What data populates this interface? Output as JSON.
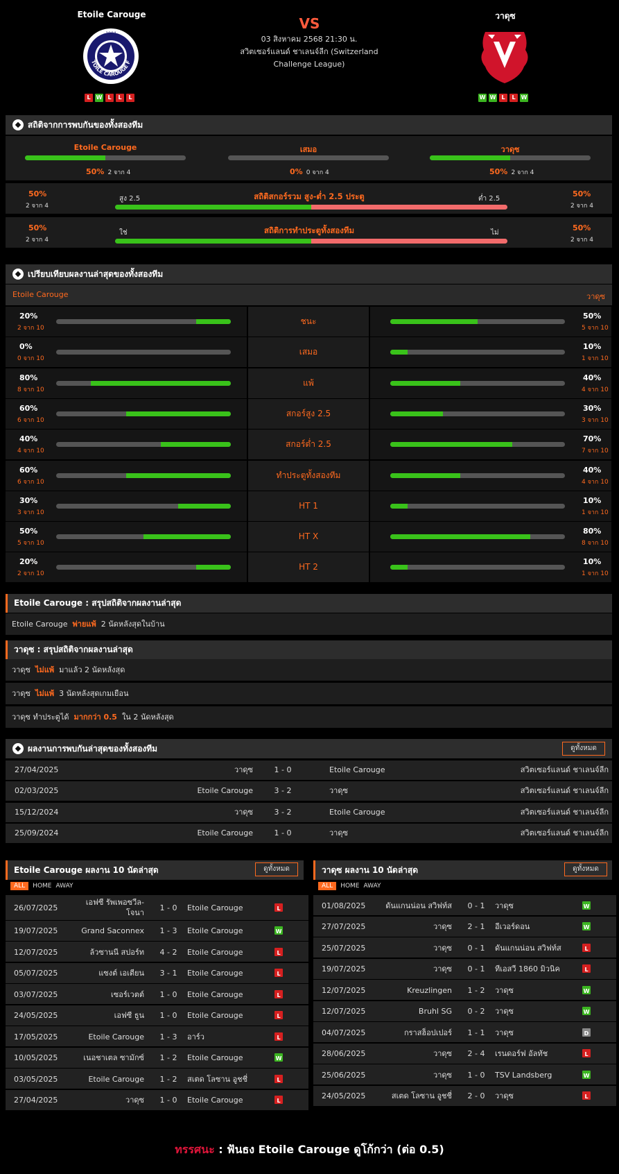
{
  "match": {
    "home": "Etoile Carouge",
    "away": "วาดุซ",
    "vs": "VS",
    "date": "03 สิงหาคม 2568 21:30 น.",
    "league1": "สวิตเซอร์แลนด์ ชาเลนจ์ลีก (Switzerland",
    "league2": "Challenge League)",
    "home_form": [
      "L",
      "W",
      "L",
      "L",
      "L"
    ],
    "away_form": [
      "W",
      "W",
      "L",
      "L",
      "W"
    ],
    "home_logo_text": "ETOILE CAROUGE FC",
    "home_logo_year": "1904"
  },
  "h2h_stats": {
    "title": "สถิติจากการพบกันของทั้งสองทีม",
    "cols": [
      {
        "label": "Etoile Carouge",
        "pct": "50%",
        "of": "2 จาก 4",
        "fill": 0.5
      },
      {
        "label": "เสมอ",
        "pct": "0%",
        "of": "0 จาก 4",
        "fill": 0
      },
      {
        "label": "วาดุซ",
        "pct": "50%",
        "of": "2 จาก 4",
        "fill": 0.5
      }
    ],
    "ou": {
      "title": "สถิติสกอร์รวม สูง-ต่ำ 2.5 ประตู",
      "left_label": "สูง 2.5",
      "right_label": "ต่ำ 2.5",
      "lpct": "50%",
      "lof": "2 จาก 4",
      "rpct": "50%",
      "rof": "2 จาก 4",
      "fill": 0.5
    },
    "btts": {
      "title": "สถิติการทำประตูทั้งสองทีม",
      "left_label": "ใช่",
      "right_label": "ไม่",
      "lpct": "50%",
      "lof": "2 จาก 4",
      "rpct": "50%",
      "rof": "2 จาก 4",
      "fill": 0.5
    }
  },
  "compare": {
    "title": "เปรียบเทียบผลงานล่าสุดของทั้งสองทีม",
    "home": "Etoile Carouge",
    "away": "วาดุซ",
    "rows": [
      {
        "label": "ชนะ",
        "lp": "20%",
        "lo": "2 จาก 10",
        "lf": 0.2,
        "rp": "50%",
        "ro": "5 จาก 10",
        "rf": 0.5
      },
      {
        "label": "เสมอ",
        "lp": "0%",
        "lo": "0 จาก 10",
        "lf": 0,
        "rp": "10%",
        "ro": "1 จาก 10",
        "rf": 0.1
      },
      {
        "label": "แพ้",
        "lp": "80%",
        "lo": "8 จาก 10",
        "lf": 0.8,
        "rp": "40%",
        "ro": "4 จาก 10",
        "rf": 0.4
      },
      {
        "label": "สกอร์สูง 2.5",
        "lp": "60%",
        "lo": "6 จาก 10",
        "lf": 0.6,
        "rp": "30%",
        "ro": "3 จาก 10",
        "rf": 0.3
      },
      {
        "label": "สกอร์ต่ำ 2.5",
        "lp": "40%",
        "lo": "4 จาก 10",
        "lf": 0.4,
        "rp": "70%",
        "ro": "7 จาก 10",
        "rf": 0.7
      },
      {
        "label": "ทำประตูทั้งสองทีม",
        "lp": "60%",
        "lo": "6 จาก 10",
        "lf": 0.6,
        "rp": "40%",
        "ro": "4 จาก 10",
        "rf": 0.4
      },
      {
        "label": "HT 1",
        "lp": "30%",
        "lo": "3 จาก 10",
        "lf": 0.3,
        "rp": "10%",
        "ro": "1 จาก 10",
        "rf": 0.1
      },
      {
        "label": "HT X",
        "lp": "50%",
        "lo": "5 จาก 10",
        "lf": 0.5,
        "rp": "80%",
        "ro": "8 จาก 10",
        "rf": 0.8
      },
      {
        "label": "HT 2",
        "lp": "20%",
        "lo": "2 จาก 10",
        "lf": 0.2,
        "rp": "10%",
        "ro": "1 จาก 10",
        "rf": 0.1
      }
    ]
  },
  "summary_home": {
    "title": "Etoile Carouge : สรุปสถิติจากผลงานล่าสุด",
    "rows": [
      {
        "a": "Etoile Carouge",
        "b": "พ่ายแพ้",
        "c": "2 นัดหลังสุดในบ้าน"
      }
    ]
  },
  "summary_away": {
    "title": "วาดุซ : สรุปสถิติจากผลงานล่าสุด",
    "rows": [
      {
        "a": "วาดุซ",
        "b": "ไม่แพ้",
        "c": "มาแล้ว 2 นัดหลังสุด"
      },
      {
        "a": "วาดุซ",
        "b": "ไม่แพ้",
        "c": "3 นัดหลังสุดเกมเยือน"
      }
    ],
    "row3": {
      "a": "วาดุซ ทำประตูได้",
      "b": "มากกว่า 0.5",
      "c": "ใน 2 นัดหลังสุด"
    }
  },
  "h2h_results": {
    "title": "ผลงานการพบกันล่าสุดของทั้งสองทีม",
    "button": "ดูทั้งหมด",
    "rows": [
      {
        "date": "27/04/2025",
        "home": "วาดุซ",
        "score": "1 - 0",
        "away": "Etoile Carouge",
        "league": "สวิตเซอร์แลนด์ ชาเลนจ์ลีก"
      },
      {
        "date": "02/03/2025",
        "home": "Etoile Carouge",
        "score": "3 - 2",
        "away": "วาดุซ",
        "league": "สวิตเซอร์แลนด์ ชาเลนจ์ลีก"
      },
      {
        "date": "15/12/2024",
        "home": "วาดุซ",
        "score": "3 - 2",
        "away": "Etoile Carouge",
        "league": "สวิตเซอร์แลนด์ ชาเลนจ์ลีก"
      },
      {
        "date": "25/09/2024",
        "home": "Etoile Carouge",
        "score": "1 - 0",
        "away": "วาดุซ",
        "league": "สวิตเซอร์แลนด์ ชาเลนจ์ลีก"
      }
    ]
  },
  "tabs": {
    "all": "ALL",
    "home": "HOME",
    "away": "AWAY"
  },
  "home_last": {
    "title": "Etoile Carouge ผลงาน 10 นัดล่าสุด",
    "button": "ดูทั้งหมด",
    "rows": [
      {
        "date": "26/07/2025",
        "home": "เอฟซี รัพเพอซวีล-",
        "home2": "โจนา",
        "score": "1 - 0",
        "away": "Etoile Carouge",
        "r": "L"
      },
      {
        "date": "19/07/2025",
        "home": "Grand Saconnex",
        "score": "1 - 3",
        "away": "Etoile Carouge",
        "r": "W"
      },
      {
        "date": "12/07/2025",
        "home": "ล้วซานนี สปอร์ท",
        "score": "4 - 2",
        "away": "Etoile Carouge",
        "r": "L"
      },
      {
        "date": "05/07/2025",
        "home": "แซงต์ เอเตียน",
        "score": "3 - 1",
        "away": "Etoile Carouge",
        "r": "L"
      },
      {
        "date": "03/07/2025",
        "home": "เซอร์เวตต์",
        "score": "1 - 0",
        "away": "Etoile Carouge",
        "r": "L"
      },
      {
        "date": "24/05/2025",
        "home": "เอฟซี ธูน",
        "score": "1 - 0",
        "away": "Etoile Carouge",
        "r": "L"
      },
      {
        "date": "17/05/2025",
        "home": "Etoile Carouge",
        "score": "1 - 3",
        "away": "อาร์ว",
        "r": "L"
      },
      {
        "date": "10/05/2025",
        "home": "เนอชาเตล ซามักซ์",
        "score": "1 - 2",
        "away": "Etoile Carouge",
        "r": "W"
      },
      {
        "date": "03/05/2025",
        "home": "Etoile Carouge",
        "score": "1 - 2",
        "away": "สเตด โลซาน อูชชี่",
        "r": "L"
      },
      {
        "date": "27/04/2025",
        "home": "วาดุซ",
        "score": "1 - 0",
        "away": "Etoile Carouge",
        "r": "L"
      }
    ]
  },
  "away_last": {
    "title": "วาดุซ ผลงาน 10 นัดล่าสุด",
    "button": "ดูทั้งหมด",
    "rows": [
      {
        "date": "01/08/2025",
        "home": "ดันแกนน่อน สวิฟท์ส",
        "score": "0 - 1",
        "away": "วาดุซ",
        "r": "W"
      },
      {
        "date": "27/07/2025",
        "home": "วาดุซ",
        "score": "2 - 1",
        "away": "อีเวอร์ดอน",
        "r": "W"
      },
      {
        "date": "25/07/2025",
        "home": "วาดุซ",
        "score": "0 - 1",
        "away": "ดันแกนน่อน สวิฟท์ส",
        "r": "L"
      },
      {
        "date": "19/07/2025",
        "home": "วาดุซ",
        "score": "0 - 1",
        "away": "ทีเอสวี 1860 มิวนิค",
        "r": "L"
      },
      {
        "date": "12/07/2025",
        "home": "Kreuzlingen",
        "score": "1 - 2",
        "away": "วาดุซ",
        "r": "W"
      },
      {
        "date": "12/07/2025",
        "home": "Bruhl SG",
        "score": "0 - 2",
        "away": "วาดุซ",
        "r": "W"
      },
      {
        "date": "04/07/2025",
        "home": "กราสฮ็อปเปอร์",
        "score": "1 - 1",
        "away": "วาดุซ",
        "r": "D"
      },
      {
        "date": "28/06/2025",
        "home": "วาดุซ",
        "score": "2 - 4",
        "away": "เรนดอร์ฟ อัลทัช",
        "r": "L"
      },
      {
        "date": "25/06/2025",
        "home": "วาดุซ",
        "score": "1 - 0",
        "away": "TSV Landsberg",
        "r": "W"
      },
      {
        "date": "24/05/2025",
        "home": "สเตด โลซาน อูชชี่",
        "score": "2 - 0",
        "away": "วาดุซ",
        "r": "L"
      }
    ]
  },
  "verdict": {
    "label": "ทรรศนะ",
    "sep": ":",
    "text": "ฟันธง Etoile Carouge ดูโก้กว่า (ต่อ 0.5)"
  }
}
